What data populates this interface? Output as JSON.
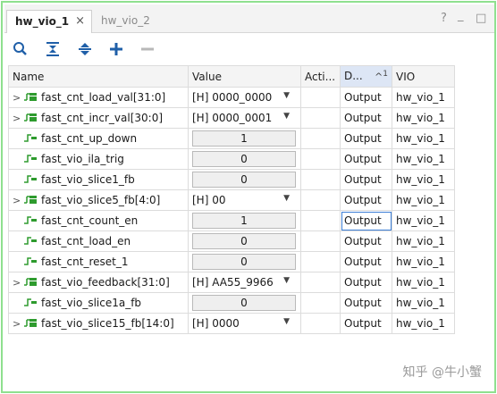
{
  "tabs": [
    {
      "label": "hw_vio_1",
      "close": "×"
    },
    {
      "label": "hw_vio_2"
    }
  ],
  "window_controls": {
    "help": "?",
    "minimize": "_",
    "maximize": "□"
  },
  "toolbar": {
    "icons": [
      "search-icon",
      "collapse-all-icon",
      "expand-all-icon",
      "add-icon",
      "remove-icon"
    ]
  },
  "columns": {
    "name": "Name",
    "value": "Value",
    "activity": "Acti...",
    "direction": "D...",
    "sort_indicator": "^",
    "sort_order": "1",
    "vio": "VIO"
  },
  "rows": [
    {
      "expandable": true,
      "bus": true,
      "name": "fast_cnt_load_val[31:0]",
      "value": "[H] 0000_0000",
      "value_type": "dropdown",
      "direction": "Output",
      "vio": "hw_vio_1"
    },
    {
      "expandable": true,
      "bus": true,
      "name": "fast_cnt_incr_val[30:0]",
      "value": "[H] 0000_0001",
      "value_type": "dropdown",
      "direction": "Output",
      "vio": "hw_vio_1"
    },
    {
      "expandable": false,
      "bus": false,
      "name": "fast_cnt_up_down",
      "value": "1",
      "value_type": "input",
      "direction": "Output",
      "vio": "hw_vio_1"
    },
    {
      "expandable": false,
      "bus": false,
      "name": "fast_vio_ila_trig",
      "value": "0",
      "value_type": "input",
      "direction": "Output",
      "vio": "hw_vio_1"
    },
    {
      "expandable": false,
      "bus": false,
      "name": "fast_vio_slice1_fb",
      "value": "0",
      "value_type": "input",
      "direction": "Output",
      "vio": "hw_vio_1"
    },
    {
      "expandable": true,
      "bus": true,
      "name": "fast_vio_slice5_fb[4:0]",
      "value": "[H] 00",
      "value_type": "dropdown",
      "direction": "Output",
      "vio": "hw_vio_1"
    },
    {
      "expandable": false,
      "bus": false,
      "name": "fast_cnt_count_en",
      "value": "1",
      "value_type": "input",
      "direction": "Output",
      "vio": "hw_vio_1",
      "selected": true
    },
    {
      "expandable": false,
      "bus": false,
      "name": "fast_cnt_load_en",
      "value": "0",
      "value_type": "input",
      "direction": "Output",
      "vio": "hw_vio_1"
    },
    {
      "expandable": false,
      "bus": false,
      "name": "fast_cnt_reset_1",
      "value": "0",
      "value_type": "input",
      "direction": "Output",
      "vio": "hw_vio_1"
    },
    {
      "expandable": true,
      "bus": true,
      "name": "fast_vio_feedback[31:0]",
      "value": "[H] AA55_9966",
      "value_type": "dropdown",
      "direction": "Output",
      "vio": "hw_vio_1"
    },
    {
      "expandable": false,
      "bus": false,
      "name": "fast_vio_slice1a_fb",
      "value": "0",
      "value_type": "input",
      "direction": "Output",
      "vio": "hw_vio_1"
    },
    {
      "expandable": true,
      "bus": true,
      "name": "fast_vio_slice15_fb[14:0]",
      "value": "[H] 0000",
      "value_type": "dropdown",
      "direction": "Output",
      "vio": "hw_vio_1"
    }
  ],
  "watermark": "知乎 @牛小蟹",
  "colors": {
    "accent_green": "#2e9b2e",
    "frame_green": "#8fe08f",
    "toolbar_blue": "#1f5fa8",
    "selection_blue": "#3d7fd6"
  }
}
